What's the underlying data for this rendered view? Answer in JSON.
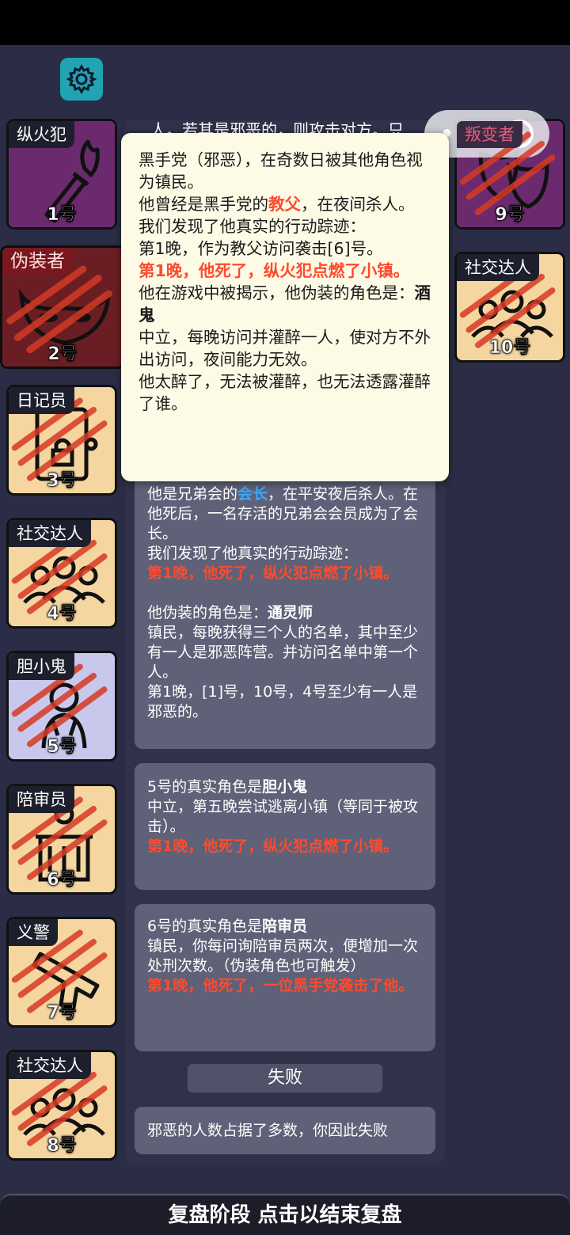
{
  "cards": [
    {
      "name": "纵火犯",
      "num": "1号",
      "icon": "torch-icon",
      "bg": "#6b2a6e",
      "dead": false
    },
    {
      "name": "伪装者",
      "num": "2号",
      "icon": "mask-icon",
      "bg": "#6a1e24",
      "dead": true
    },
    {
      "name": "日记员",
      "num": "3号",
      "icon": "locked-diary-icon",
      "bg": "#f5d6a0",
      "dead": true
    },
    {
      "name": "社交达人",
      "num": "4号",
      "icon": "crowd-icon",
      "bg": "#f5d6a0",
      "dead": true
    },
    {
      "name": "胆小鬼",
      "num": "5号",
      "icon": "scared-person-icon",
      "bg": "#c8c8ec",
      "dead": true
    },
    {
      "name": "陪审员",
      "num": "6号",
      "icon": "jury-box-icon",
      "bg": "#f5d6a0",
      "dead": true
    },
    {
      "name": "义警",
      "num": "7号",
      "icon": "pistol-icon",
      "bg": "#f5d6a0",
      "dead": true
    },
    {
      "name": "社交达人",
      "num": "8号",
      "icon": "crowd-icon",
      "bg": "#f5d6a0",
      "dead": true
    },
    {
      "name": "叛变者",
      "num": "9号",
      "icon": "theater-masks-icon",
      "bg": "#6b2a6e",
      "dead": true
    },
    {
      "name": "社交达人",
      "num": "10号",
      "icon": "crowd-icon",
      "bg": "#f5d6a0",
      "dead": true
    }
  ],
  "cut_text": "人。若其是邪恶的，则攻击对方。只",
  "tooltip": {
    "l1": "黑手党（邪恶），在奇数日被其他角色视为镇民。",
    "l2a": "他曾经是黑手党的",
    "l2b": "教父",
    "l2c": "，在夜间杀人。",
    "l3": "我们发现了他真实的行动踪迹：",
    "l4": "第1晚，作为教父访问袭击[6]号。",
    "l5": "第1晚，他死了，纵火犯点燃了小镇。",
    "l6a": "他在游戏中被揭示，他伪装的角色是：",
    "l6b": "酒鬼",
    "l7": "中立，每晚访问并灌醉一人，使对方不外出访问，夜间能力无效。",
    "l8": "他太醉了，无法被灌醉，也无法透露灌醉了谁。"
  },
  "box1": {
    "a": "他是兄弟会的",
    "b": "会长",
    "c": "，在平安夜后杀人。在他死后，一名存活的兄弟会会员成为了会长。",
    "d": "我们发现了他真实的行动踪迹：",
    "e": "第1晚，他死了，纵火犯点燃了小镇。",
    "f": "他伪装的角色是：",
    "g": "通灵师",
    "h": "镇民，每晚获得三个人的名单，其中至少有一人是邪恶阵营。并访问名单中第一个人。",
    "i": "第1晚，[1]号，10号，4号至少有一人是邪恶的。"
  },
  "box2": {
    "a": "5号的真实角色是",
    "b": "胆小鬼",
    "c": "中立，第五晚尝试逃离小镇（等同于被攻击）。",
    "d": "第1晚，他死了，纵火犯点燃了小镇。"
  },
  "box3": {
    "a": "6号的真实角色是",
    "b": "陪审员",
    "c": "镇民，你每问询陪审员两次，便增加一次处刑次数。（伪装角色也可触发）",
    "d": "第1晚，他死了，一位黑手党袭击了他。"
  },
  "fail_label": "失败",
  "box4": {
    "a": "邪恶的人数占据了多数，你因此失败"
  },
  "bottom_bar": "复盘阶段 点击以结束复盘"
}
